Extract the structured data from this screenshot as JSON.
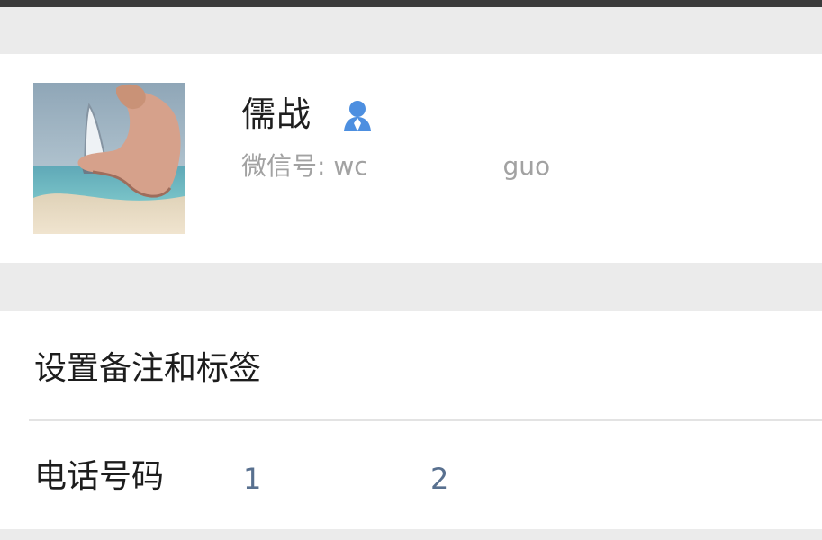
{
  "profile": {
    "name": "儒战",
    "wechat_label": "微信号:",
    "wechat_id_start": "wc",
    "wechat_id_end": "guo",
    "contact_icon": "person-icon",
    "accent_color": "#4d8fe0"
  },
  "rows": {
    "remark_label": "设置备注和标签",
    "phone_label": "电话号码",
    "phone_start": "1",
    "phone_end": "2"
  }
}
